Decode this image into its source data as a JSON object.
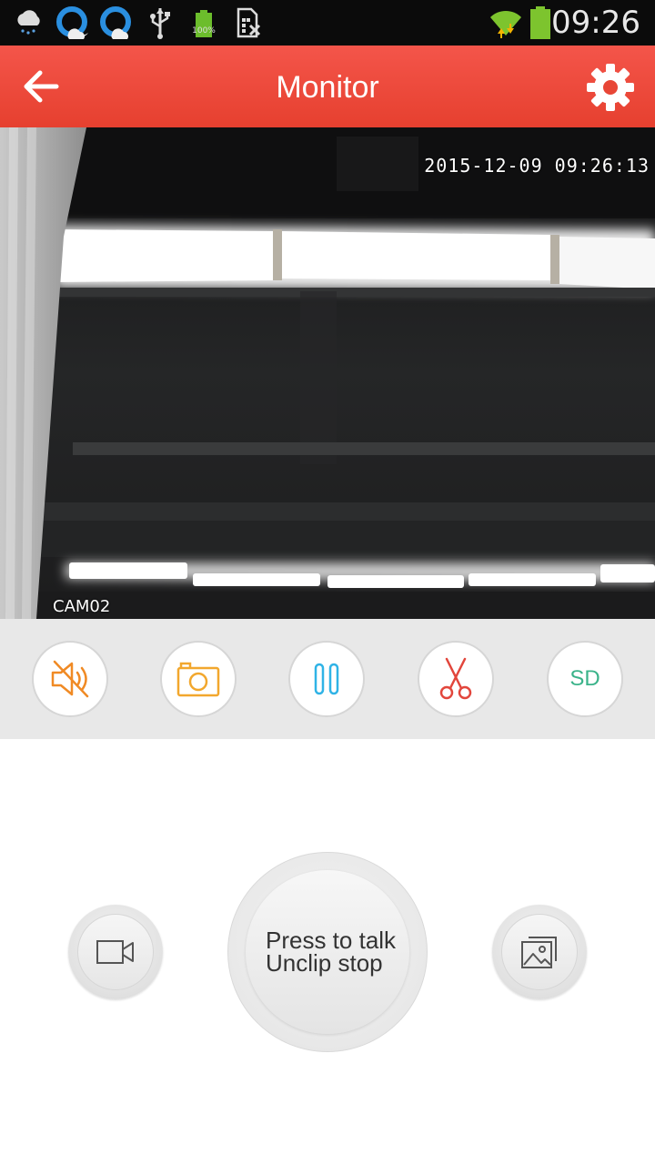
{
  "status_bar": {
    "time": "09:26",
    "icons": [
      "cloud-rain-icon",
      "q-app-icon",
      "q-app-icon",
      "usb-icon",
      "battery-100-icon",
      "sim-off-icon",
      "wifi-icon",
      "battery-icon"
    ],
    "battery_small_label": "100%"
  },
  "app_bar": {
    "title": "Monitor",
    "back_icon": "back-arrow-icon",
    "settings_icon": "gear-icon",
    "color": "#ea4636"
  },
  "video": {
    "timestamp": "2015-12-09 09:26:13",
    "camera_name": "CAM02"
  },
  "controls": [
    {
      "name": "mute-button",
      "icon": "speaker-muted-icon",
      "color": "#f08a24"
    },
    {
      "name": "snapshot-button",
      "icon": "camera-icon",
      "color": "#f2a72d"
    },
    {
      "name": "pause-button",
      "icon": "pause-icon",
      "color": "#2fb3e6"
    },
    {
      "name": "clip-button",
      "icon": "scissors-icon",
      "color": "#e2463c"
    },
    {
      "name": "quality-button",
      "label": "SD",
      "color": "#3bb38a"
    }
  ],
  "talk": {
    "line1": "Press to talk",
    "line2": "Unclip stop"
  },
  "bottom_buttons": {
    "left_icon": "video-camera-icon",
    "right_icon": "gallery-icon"
  }
}
